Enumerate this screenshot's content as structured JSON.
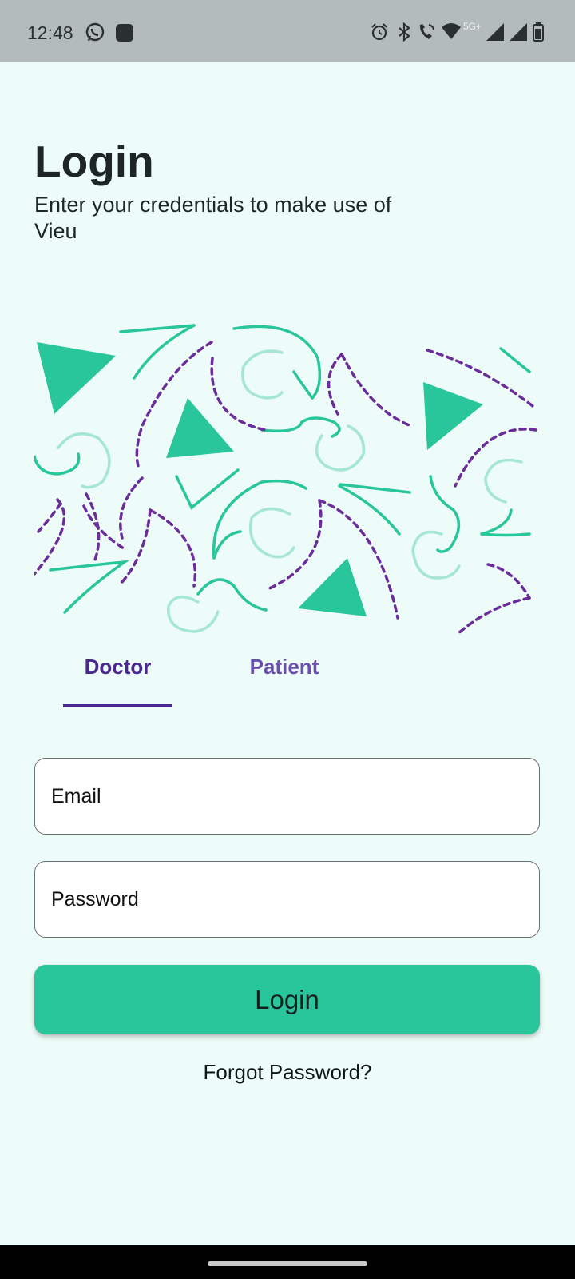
{
  "status_bar": {
    "time": "12:48",
    "network_label": "5G+",
    "left_icons": [
      "whatsapp-icon",
      "app-notification-icon"
    ],
    "right_icons": [
      "alarm-icon",
      "bluetooth-icon",
      "wifi-call-icon",
      "wifi-icon",
      "signal-icon",
      "signal-icon",
      "battery-icon"
    ]
  },
  "header": {
    "title": "Login",
    "subtitle": "Enter your credentials to make use of Vieu"
  },
  "tabs": [
    {
      "label": "Doctor",
      "selected": true
    },
    {
      "label": "Patient",
      "selected": false
    }
  ],
  "form": {
    "email_placeholder": "Email",
    "password_placeholder": "Password",
    "login_label": "Login",
    "forgot_label": "Forgot Password?"
  },
  "colors": {
    "background": "#edfcf8",
    "accent": "#29c59b",
    "tab_selected": "#4b2890",
    "tab_unselected": "#6b4fae",
    "pattern_purple": "#6a2d9a",
    "pattern_light": "#a6e6d4"
  }
}
